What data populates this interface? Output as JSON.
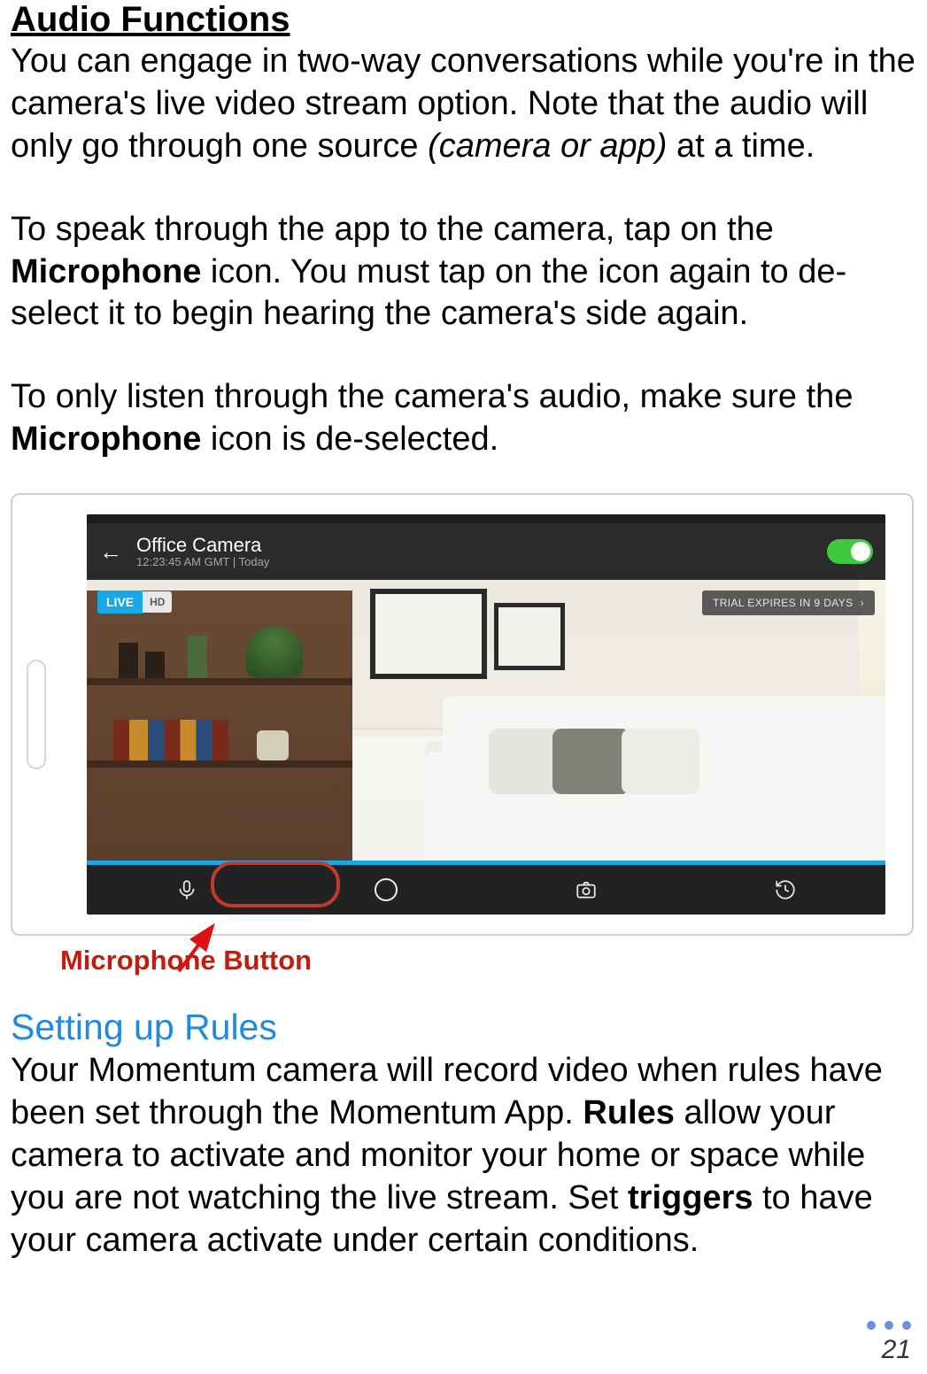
{
  "heading_audio": "Audio Functions",
  "para1_a": "You can engage in two-way conversations while you're in the camera's live video stream option. Note that the audio will only go through one source ",
  "para1_em": "(camera or app)",
  "para1_b": " at a time.",
  "para2_a": "To speak through the app to the camera, tap on the ",
  "para2_bold": "Microphone",
  "para2_b": " icon. You must tap on the icon again to de-select it to begin hearing the camera's side again.",
  "para3_a": "To only listen through the camera's audio, make sure the ",
  "para3_bold": "Microphone",
  "para3_b": " icon is de-selected.",
  "screenshot": {
    "camera_title": "Office Camera",
    "camera_time": "12:23:45 AM GMT  |  Today",
    "live_label": "LIVE",
    "hd_label": "HD",
    "trial_label": "TRIAL EXPIRES IN 9 DAYS",
    "trial_chevron": "›"
  },
  "mic_caption": "Microphone Button",
  "heading_rules": "Setting up Rules",
  "rules_a": "Your Momentum camera will record video when rules have been set through the Momentum App. ",
  "rules_bold1": "Rules",
  "rules_b": " allow your camera to activate and monitor your home or space while you are not watching the live stream. Set ",
  "rules_bold2": "triggers",
  "rules_c": " to have your camera activate under certain conditions.",
  "page_number": "21"
}
